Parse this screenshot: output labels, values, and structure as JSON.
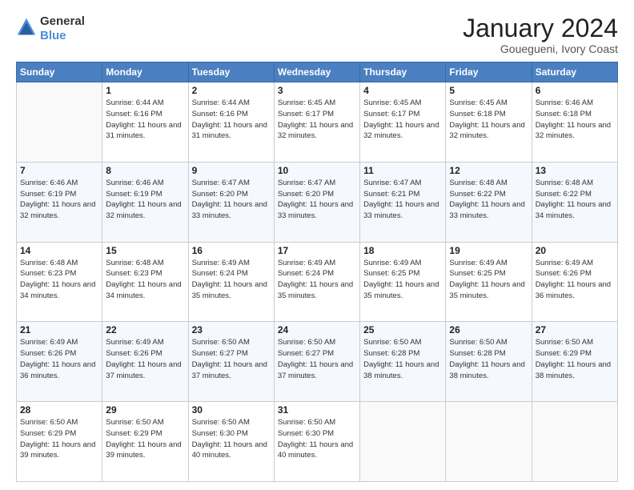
{
  "header": {
    "logo_general": "General",
    "logo_blue": "Blue",
    "month": "January 2024",
    "location": "Gouegueni, Ivory Coast"
  },
  "weekdays": [
    "Sunday",
    "Monday",
    "Tuesday",
    "Wednesday",
    "Thursday",
    "Friday",
    "Saturday"
  ],
  "weeks": [
    [
      {
        "day": "",
        "sunrise": "",
        "sunset": "",
        "daylight": ""
      },
      {
        "day": "1",
        "sunrise": "Sunrise: 6:44 AM",
        "sunset": "Sunset: 6:16 PM",
        "daylight": "Daylight: 11 hours and 31 minutes."
      },
      {
        "day": "2",
        "sunrise": "Sunrise: 6:44 AM",
        "sunset": "Sunset: 6:16 PM",
        "daylight": "Daylight: 11 hours and 31 minutes."
      },
      {
        "day": "3",
        "sunrise": "Sunrise: 6:45 AM",
        "sunset": "Sunset: 6:17 PM",
        "daylight": "Daylight: 11 hours and 32 minutes."
      },
      {
        "day": "4",
        "sunrise": "Sunrise: 6:45 AM",
        "sunset": "Sunset: 6:17 PM",
        "daylight": "Daylight: 11 hours and 32 minutes."
      },
      {
        "day": "5",
        "sunrise": "Sunrise: 6:45 AM",
        "sunset": "Sunset: 6:18 PM",
        "daylight": "Daylight: 11 hours and 32 minutes."
      },
      {
        "day": "6",
        "sunrise": "Sunrise: 6:46 AM",
        "sunset": "Sunset: 6:18 PM",
        "daylight": "Daylight: 11 hours and 32 minutes."
      }
    ],
    [
      {
        "day": "7",
        "sunrise": "Sunrise: 6:46 AM",
        "sunset": "Sunset: 6:19 PM",
        "daylight": "Daylight: 11 hours and 32 minutes."
      },
      {
        "day": "8",
        "sunrise": "Sunrise: 6:46 AM",
        "sunset": "Sunset: 6:19 PM",
        "daylight": "Daylight: 11 hours and 32 minutes."
      },
      {
        "day": "9",
        "sunrise": "Sunrise: 6:47 AM",
        "sunset": "Sunset: 6:20 PM",
        "daylight": "Daylight: 11 hours and 33 minutes."
      },
      {
        "day": "10",
        "sunrise": "Sunrise: 6:47 AM",
        "sunset": "Sunset: 6:20 PM",
        "daylight": "Daylight: 11 hours and 33 minutes."
      },
      {
        "day": "11",
        "sunrise": "Sunrise: 6:47 AM",
        "sunset": "Sunset: 6:21 PM",
        "daylight": "Daylight: 11 hours and 33 minutes."
      },
      {
        "day": "12",
        "sunrise": "Sunrise: 6:48 AM",
        "sunset": "Sunset: 6:22 PM",
        "daylight": "Daylight: 11 hours and 33 minutes."
      },
      {
        "day": "13",
        "sunrise": "Sunrise: 6:48 AM",
        "sunset": "Sunset: 6:22 PM",
        "daylight": "Daylight: 11 hours and 34 minutes."
      }
    ],
    [
      {
        "day": "14",
        "sunrise": "Sunrise: 6:48 AM",
        "sunset": "Sunset: 6:23 PM",
        "daylight": "Daylight: 11 hours and 34 minutes."
      },
      {
        "day": "15",
        "sunrise": "Sunrise: 6:48 AM",
        "sunset": "Sunset: 6:23 PM",
        "daylight": "Daylight: 11 hours and 34 minutes."
      },
      {
        "day": "16",
        "sunrise": "Sunrise: 6:49 AM",
        "sunset": "Sunset: 6:24 PM",
        "daylight": "Daylight: 11 hours and 35 minutes."
      },
      {
        "day": "17",
        "sunrise": "Sunrise: 6:49 AM",
        "sunset": "Sunset: 6:24 PM",
        "daylight": "Daylight: 11 hours and 35 minutes."
      },
      {
        "day": "18",
        "sunrise": "Sunrise: 6:49 AM",
        "sunset": "Sunset: 6:25 PM",
        "daylight": "Daylight: 11 hours and 35 minutes."
      },
      {
        "day": "19",
        "sunrise": "Sunrise: 6:49 AM",
        "sunset": "Sunset: 6:25 PM",
        "daylight": "Daylight: 11 hours and 35 minutes."
      },
      {
        "day": "20",
        "sunrise": "Sunrise: 6:49 AM",
        "sunset": "Sunset: 6:26 PM",
        "daylight": "Daylight: 11 hours and 36 minutes."
      }
    ],
    [
      {
        "day": "21",
        "sunrise": "Sunrise: 6:49 AM",
        "sunset": "Sunset: 6:26 PM",
        "daylight": "Daylight: 11 hours and 36 minutes."
      },
      {
        "day": "22",
        "sunrise": "Sunrise: 6:49 AM",
        "sunset": "Sunset: 6:26 PM",
        "daylight": "Daylight: 11 hours and 37 minutes."
      },
      {
        "day": "23",
        "sunrise": "Sunrise: 6:50 AM",
        "sunset": "Sunset: 6:27 PM",
        "daylight": "Daylight: 11 hours and 37 minutes."
      },
      {
        "day": "24",
        "sunrise": "Sunrise: 6:50 AM",
        "sunset": "Sunset: 6:27 PM",
        "daylight": "Daylight: 11 hours and 37 minutes."
      },
      {
        "day": "25",
        "sunrise": "Sunrise: 6:50 AM",
        "sunset": "Sunset: 6:28 PM",
        "daylight": "Daylight: 11 hours and 38 minutes."
      },
      {
        "day": "26",
        "sunrise": "Sunrise: 6:50 AM",
        "sunset": "Sunset: 6:28 PM",
        "daylight": "Daylight: 11 hours and 38 minutes."
      },
      {
        "day": "27",
        "sunrise": "Sunrise: 6:50 AM",
        "sunset": "Sunset: 6:29 PM",
        "daylight": "Daylight: 11 hours and 38 minutes."
      }
    ],
    [
      {
        "day": "28",
        "sunrise": "Sunrise: 6:50 AM",
        "sunset": "Sunset: 6:29 PM",
        "daylight": "Daylight: 11 hours and 39 minutes."
      },
      {
        "day": "29",
        "sunrise": "Sunrise: 6:50 AM",
        "sunset": "Sunset: 6:29 PM",
        "daylight": "Daylight: 11 hours and 39 minutes."
      },
      {
        "day": "30",
        "sunrise": "Sunrise: 6:50 AM",
        "sunset": "Sunset: 6:30 PM",
        "daylight": "Daylight: 11 hours and 40 minutes."
      },
      {
        "day": "31",
        "sunrise": "Sunrise: 6:50 AM",
        "sunset": "Sunset: 6:30 PM",
        "daylight": "Daylight: 11 hours and 40 minutes."
      },
      {
        "day": "",
        "sunrise": "",
        "sunset": "",
        "daylight": ""
      },
      {
        "day": "",
        "sunrise": "",
        "sunset": "",
        "daylight": ""
      },
      {
        "day": "",
        "sunrise": "",
        "sunset": "",
        "daylight": ""
      }
    ]
  ]
}
